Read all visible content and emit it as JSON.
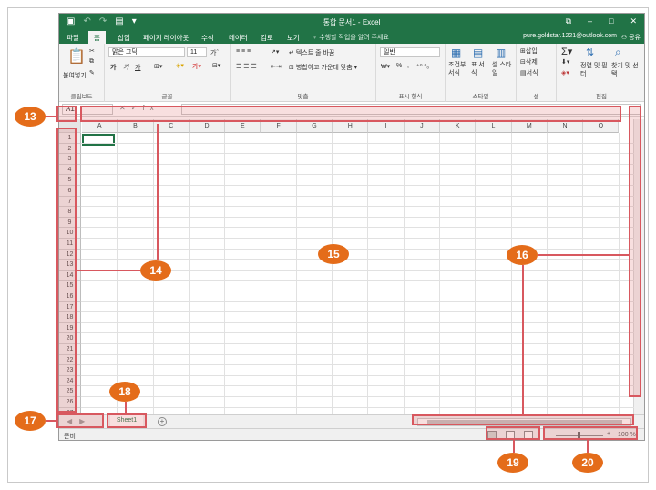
{
  "window": {
    "title": "통합 문서1 - Excel",
    "qat_icons": [
      "save-icon",
      "undo-icon",
      "redo-icon",
      "form-icon"
    ],
    "controls": [
      "ribbon-display-icon",
      "minimize-icon",
      "maximize-icon",
      "close-icon"
    ]
  },
  "tabs": [
    "파일",
    "홈",
    "삽입",
    "페이지 레이아웃",
    "수식",
    "데이터",
    "검토",
    "보기"
  ],
  "active_tab": "홈",
  "tell_me": "수행할 작업을 알려 주세요",
  "account": "pure.goldstar.1221@outlook.com",
  "share": "공유",
  "ribbon": {
    "clipboard": {
      "paste": "붙여넣기",
      "label": "클립보드"
    },
    "font": {
      "font_name": "맑은 고딕",
      "font_size": "11",
      "bold": "가",
      "italic": "가",
      "underline": "가",
      "label": "글꼴"
    },
    "alignment": {
      "wrap": "텍스트 줄 바꿈",
      "merge": "병합하고 가운데 맞춤",
      "label": "맞춤"
    },
    "number": {
      "format": "일반",
      "percent": "%",
      "label": "표시 형식"
    },
    "styles": {
      "conditional": "조건부 서식",
      "table": "표 서식",
      "cell_styles": "셀 스타일",
      "label": "스타일"
    },
    "cells": {
      "insert": "삽입",
      "delete": "삭제",
      "format": "서식",
      "label": "셀"
    },
    "editing": {
      "sort": "정렬 및 필터",
      "find": "찾기 및 선택",
      "label": "편집"
    }
  },
  "formula_bar": {
    "name_box": "A1",
    "fx": "fx",
    "value": ""
  },
  "columns": [
    "A",
    "B",
    "C",
    "D",
    "E",
    "F",
    "G",
    "H",
    "I",
    "J",
    "K",
    "L",
    "M",
    "N",
    "O"
  ],
  "rows": [
    "1",
    "2",
    "3",
    "4",
    "5",
    "6",
    "7",
    "8",
    "9",
    "10",
    "11",
    "12",
    "13",
    "14",
    "15",
    "16",
    "17",
    "18",
    "19",
    "20",
    "21",
    "22",
    "23",
    "24",
    "25",
    "26",
    "27"
  ],
  "sheet_tab": "Sheet1",
  "status": {
    "ready": "준비",
    "zoom": "100 %"
  },
  "callouts": [
    "13",
    "14",
    "15",
    "16",
    "17",
    "18",
    "19",
    "20"
  ],
  "colors": {
    "excel_green": "#217346",
    "callout_orange": "#e46c1a",
    "highlight_red": "#d8585f"
  }
}
